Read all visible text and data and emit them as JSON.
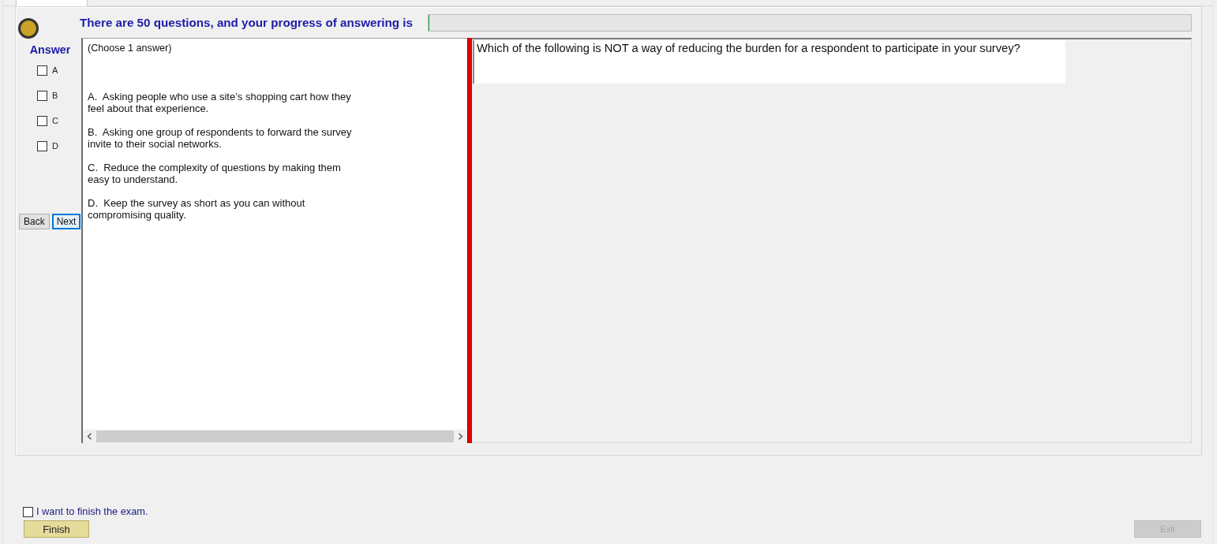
{
  "top_tab": {
    "selected": true
  },
  "header": {
    "title": "There are 50 questions, and your progress of answering is",
    "progress": {
      "level": 0
    }
  },
  "answer_sidebar": {
    "heading": "Answer",
    "choices": [
      {
        "label": "A",
        "checked": false
      },
      {
        "label": "B",
        "checked": false
      },
      {
        "label": "C",
        "checked": false
      },
      {
        "label": "D",
        "checked": false
      }
    ],
    "buttons": [
      {
        "label": "Back",
        "focused": false
      },
      {
        "label": "Next",
        "focused": true
      }
    ]
  },
  "answer_panel": {
    "instruction": "(Choose 1 answer)",
    "options": [
      "A.  Asking people who use a site’s shopping cart how they feel about that experience.",
      "B.  Asking one group of respondents to forward the survey invite to their social networks.",
      "C.  Reduce the complexity of questions by making them easy to understand.",
      "D.  Keep the survey as short as you can without compromising quality."
    ]
  },
  "question": {
    "text": "Which of the following is NOT a way of reducing the burden for a respondent to participate in your survey?"
  },
  "footer": {
    "finish_checkbox": {
      "label": "I want to finish the exam.",
      "checked": false
    },
    "finish_button": {
      "label": "Finish"
    },
    "exit_button": {
      "label": "Exit",
      "disabled": true
    }
  }
}
